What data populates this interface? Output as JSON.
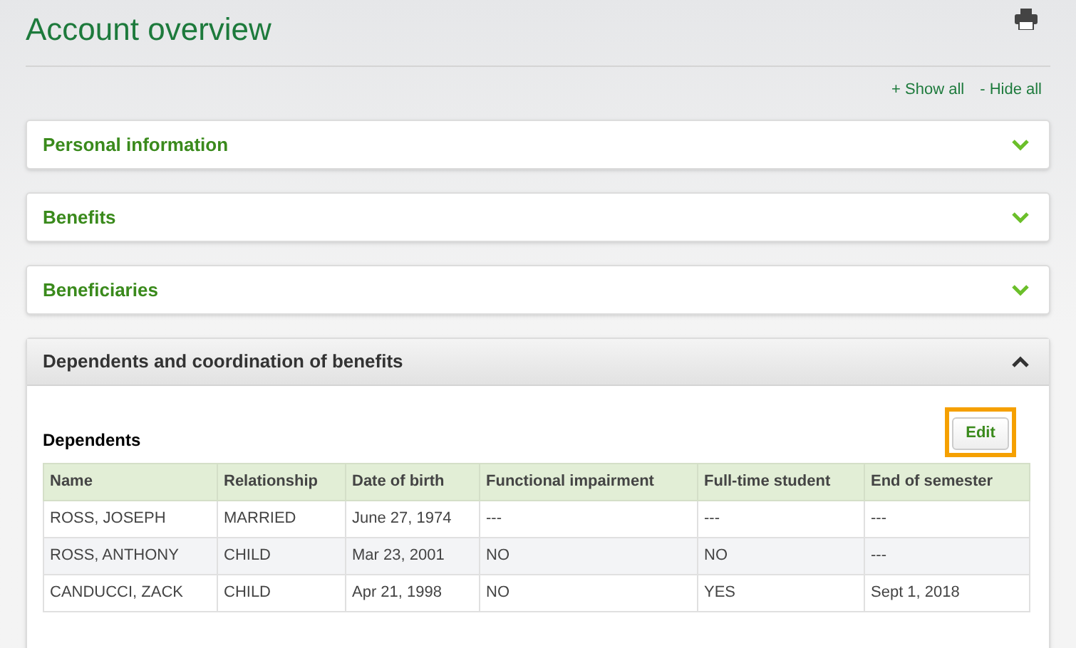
{
  "title": "Account overview",
  "links": [
    {
      "label": "+ Show all"
    },
    {
      "label": "- Hide all"
    }
  ],
  "sections": [
    {
      "title": "Personal information",
      "expanded": false
    },
    {
      "title": "Benefits",
      "expanded": false
    },
    {
      "title": "Beneficiaries",
      "expanded": false
    },
    {
      "title": "Dependents and coordination of benefits",
      "expanded": true,
      "subtitle": "Dependents",
      "edit_button": {
        "label": "Edit",
        "highlighted": true
      },
      "table": {
        "columns": [
          "Name",
          "Relationship",
          "Date of birth",
          "Functional impairment",
          "Full-time student",
          "End of semester"
        ],
        "rows": [
          [
            "ROSS, JOSEPH",
            "MARRIED",
            "June 27, 1974",
            "---",
            "---",
            "---"
          ],
          [
            "ROSS, ANTHONY",
            "CHILD",
            "Mar 23, 2001",
            "NO",
            "NO",
            "---"
          ],
          [
            "CANDUCCI, ZACK",
            "CHILD",
            "Apr 21, 1998",
            "NO",
            "YES",
            "Sept 1, 2018"
          ]
        ]
      }
    }
  ]
}
